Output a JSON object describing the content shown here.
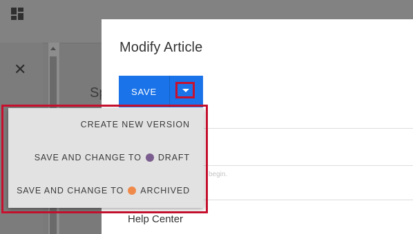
{
  "background": {
    "partial_heading": "Sp"
  },
  "modal": {
    "title": "Modify Article",
    "save_label": "SAVE",
    "field_hint": "begin.",
    "help_center_label": "Help Center"
  },
  "menu": {
    "items": [
      {
        "label": "CREATE NEW VERSION"
      },
      {
        "label": "SAVE AND CHANGE TO",
        "status": "DRAFT",
        "status_color": "#7b5e8f"
      },
      {
        "label": "SAVE AND CHANGE TO",
        "status": "ARCHIVED",
        "status_color": "#f08a4b"
      }
    ]
  },
  "colors": {
    "primary": "#1a73e8",
    "highlight": "#c8102e"
  },
  "icons": {
    "grid": "dashboard-grid-icon",
    "close": "close-icon",
    "caret": "caret-down-icon"
  }
}
